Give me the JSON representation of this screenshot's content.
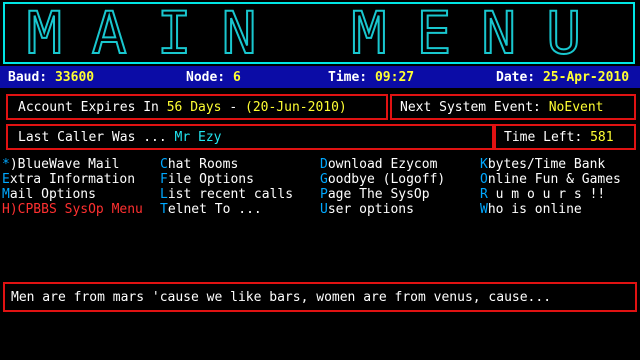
{
  "title": "MAIN MENU",
  "status": {
    "baud_label": "Baud: ",
    "baud_value": "33600",
    "node_label": "Node: ",
    "node_value": "6",
    "time_label": "Time: ",
    "time_value": "09:27",
    "date_label": "Date: ",
    "date_value": "25-Apr-2010"
  },
  "account": {
    "prefix": "Account Expires In ",
    "days": "56 Days",
    "mid": " - ",
    "date": "(20-Jun-2010)"
  },
  "next_event": {
    "label": "Next System Event: ",
    "value": "NoEvent"
  },
  "last_caller": {
    "label": "Last Caller Was ... ",
    "value": "Mr Ezy"
  },
  "time_left": {
    "label": "Time Left: ",
    "value": "581"
  },
  "menu": {
    "col1": [
      {
        "key": "*",
        "label": ")BlueWave Mail"
      },
      {
        "key": "E",
        "label": "xtra Information"
      },
      {
        "key": "M",
        "label": "ail Options"
      },
      {
        "key": "H",
        "label": ")CPBBS SysOp Menu"
      }
    ],
    "col2": [
      {
        "key": "C",
        "label": "hat Rooms"
      },
      {
        "key": "F",
        "label": "ile Options"
      },
      {
        "key": "L",
        "label": "ist recent calls"
      },
      {
        "key": "T",
        "label": "elnet To ..."
      }
    ],
    "col3": [
      {
        "key": "D",
        "label": "ownload Ezycom"
      },
      {
        "key": "G",
        "label": "oodbye (Logoff)"
      },
      {
        "key": "P",
        "label": "age The SysOp"
      },
      {
        "key": "U",
        "label": "ser options"
      }
    ],
    "col4": [
      {
        "key": "K",
        "label": "bytes/Time Bank"
      },
      {
        "key": "O",
        "label": "nline Fun & Games"
      },
      {
        "key": "R",
        "label": " u m o u r s !!"
      },
      {
        "key": "W",
        "label": "ho is online"
      }
    ]
  },
  "quote": "Men are from mars 'cause we like bars, women are from venus, cause..."
}
